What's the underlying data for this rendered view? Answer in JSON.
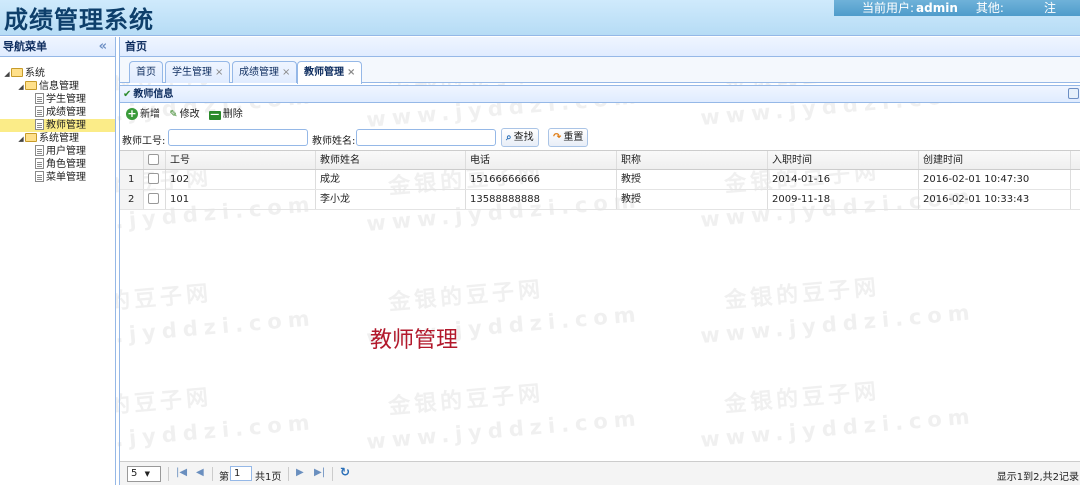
{
  "app": {
    "title": "成绩管理系统"
  },
  "userbar": {
    "user_label": "当前用户:",
    "user_name": "admin",
    "other_label": "其他:",
    "exit_label": "注"
  },
  "nav": {
    "title": "导航菜单",
    "collapse": "«",
    "tree": [
      {
        "label": "系统",
        "type": "folder",
        "level": 0,
        "toggle": "◢"
      },
      {
        "label": "信息管理",
        "type": "folder",
        "level": 1,
        "toggle": "◢"
      },
      {
        "label": "学生管理",
        "type": "file",
        "level": 2
      },
      {
        "label": "成绩管理",
        "type": "file",
        "level": 2
      },
      {
        "label": "教师管理",
        "type": "file",
        "level": 2,
        "selected": true
      },
      {
        "label": "系统管理",
        "type": "folder",
        "level": 1,
        "toggle": "◢"
      },
      {
        "label": "用户管理",
        "type": "file",
        "level": 2
      },
      {
        "label": "角色管理",
        "type": "file",
        "level": 2
      },
      {
        "label": "菜单管理",
        "type": "file",
        "level": 2
      }
    ]
  },
  "main": {
    "crumb": "首页",
    "tabs": [
      {
        "label": "首页",
        "closable": false
      },
      {
        "label": "学生管理",
        "closable": true
      },
      {
        "label": "成绩管理",
        "closable": true
      },
      {
        "label": "教师管理",
        "closable": true,
        "active": true
      }
    ],
    "tab_close": "×",
    "panel_title": "教师信息",
    "toolbar": {
      "add": "新增",
      "edit": "修改",
      "delete": "删除"
    },
    "search": {
      "id_label": "教师工号:",
      "id_value": "",
      "name_label": "教师姓名:",
      "name_value": "",
      "search_btn": "查找",
      "reset_btn": "重置"
    },
    "grid": {
      "columns": [
        "工号",
        "教师姓名",
        "电话",
        "职称",
        "入职时间",
        "创建时间"
      ],
      "rows": [
        {
          "no": "1",
          "cells": [
            "102",
            "成龙",
            "15166666666",
            "教授",
            "2014-01-16",
            "2016-02-01 10:47:30"
          ]
        },
        {
          "no": "2",
          "cells": [
            "101",
            "李小龙",
            "13588888888",
            "教授",
            "2009-11-18",
            "2016-02-01 10:33:43"
          ]
        }
      ]
    },
    "pager": {
      "page_size": "5",
      "page_label": "第",
      "page_value": "1",
      "total_pages": "共1页",
      "info": "显示1到2,共2记录"
    }
  },
  "overlay_caption": "教师管理",
  "watermark": {
    "cn": "金银的豆子网",
    "en": "www.jyddzi.com"
  }
}
